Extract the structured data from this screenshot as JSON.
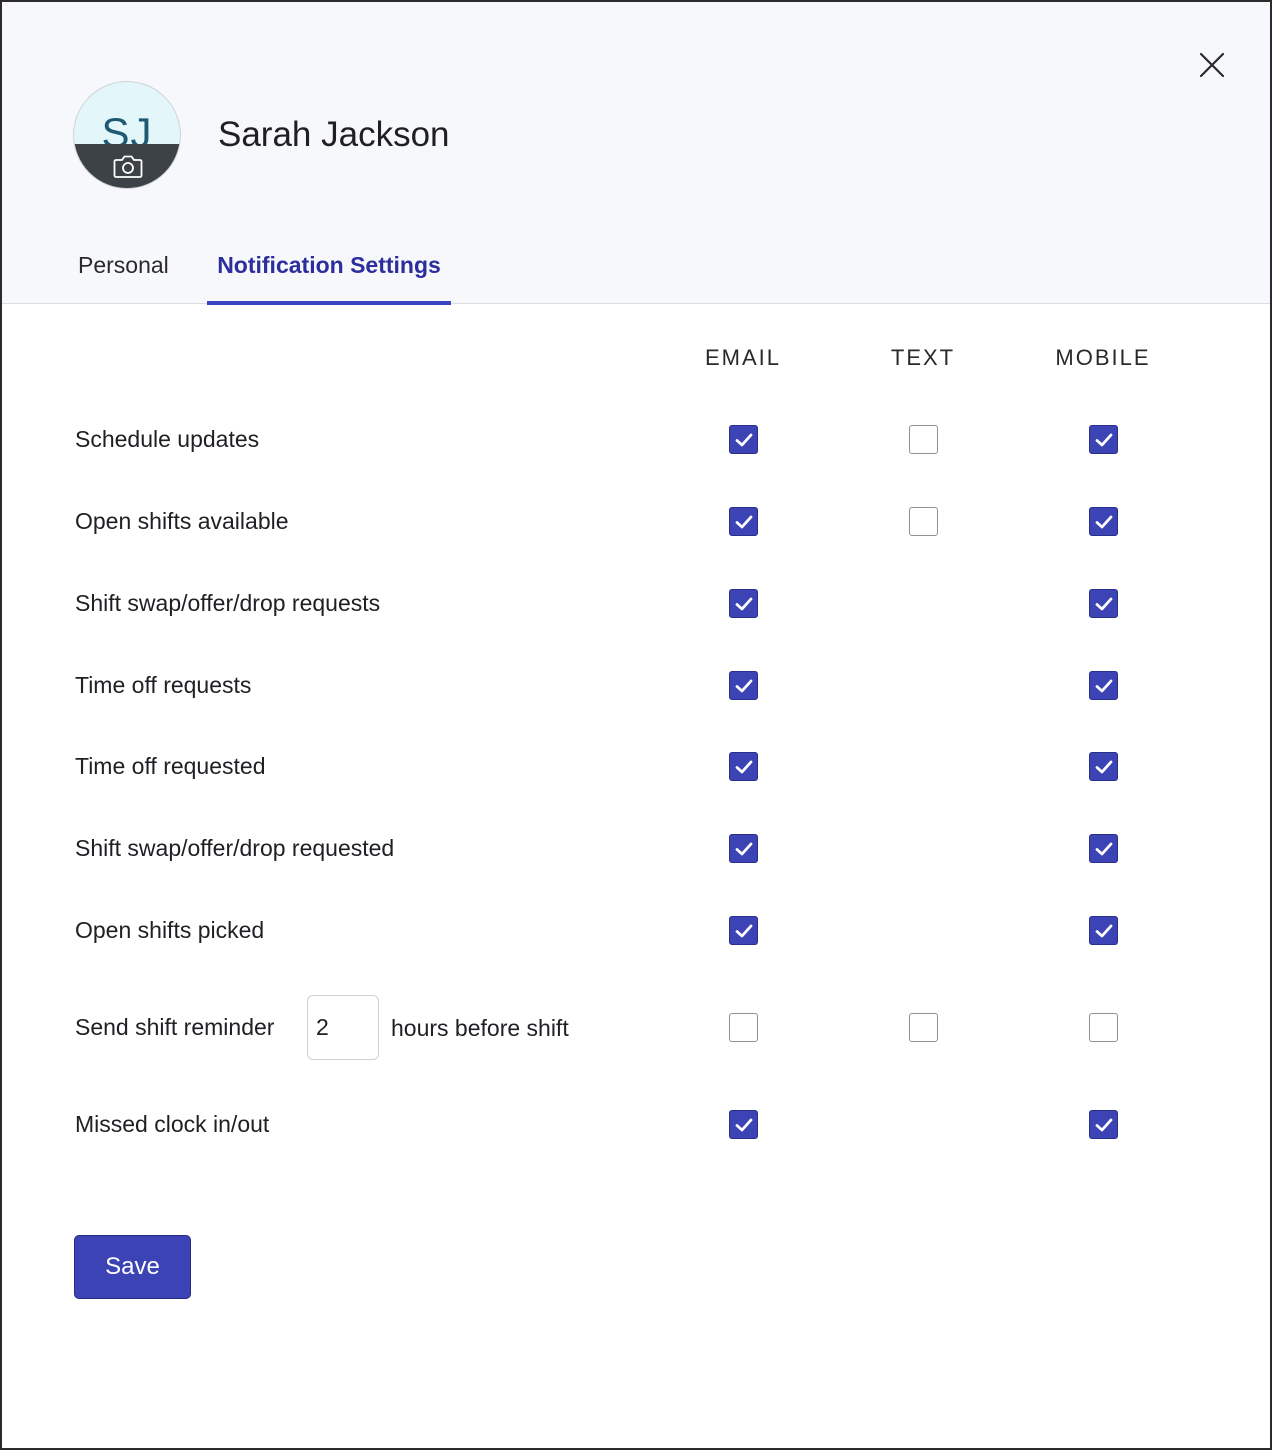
{
  "profile": {
    "initials": "SJ",
    "name": "Sarah Jackson"
  },
  "tabs": {
    "personal": "Personal",
    "notifications": "Notification Settings",
    "active": "notifications"
  },
  "columns": {
    "email": "EMAIL",
    "text": "TEXT",
    "mobile": "MOBILE"
  },
  "rows": [
    {
      "label": "Schedule updates",
      "email": true,
      "text": false,
      "mobile": true
    },
    {
      "label": "Open shifts available",
      "email": true,
      "text": false,
      "mobile": true
    },
    {
      "label": "Shift swap/offer/drop requests",
      "email": true,
      "text": null,
      "mobile": true
    },
    {
      "label": "Time off requests",
      "email": true,
      "text": null,
      "mobile": true
    },
    {
      "label": "Time off requested",
      "email": true,
      "text": null,
      "mobile": true
    },
    {
      "label": "Shift swap/offer/drop requested",
      "email": true,
      "text": null,
      "mobile": true
    },
    {
      "label": "Open shifts picked",
      "email": true,
      "text": null,
      "mobile": true
    },
    {
      "label": "Send shift reminder",
      "email": false,
      "text": false,
      "mobile": false
    },
    {
      "label": "Missed clock in/out",
      "email": true,
      "text": null,
      "mobile": true
    }
  ],
  "reminder": {
    "hours": "2",
    "suffix": "hours before shift"
  },
  "footer": {
    "save_label": "Save"
  },
  "icons": {
    "close": "close-icon",
    "camera": "camera-icon",
    "check": "checkmark-icon"
  },
  "colors": {
    "accent": "#3c43b5",
    "active_tab": "#2b2e9c",
    "header_bg": "#f7f8fb"
  }
}
